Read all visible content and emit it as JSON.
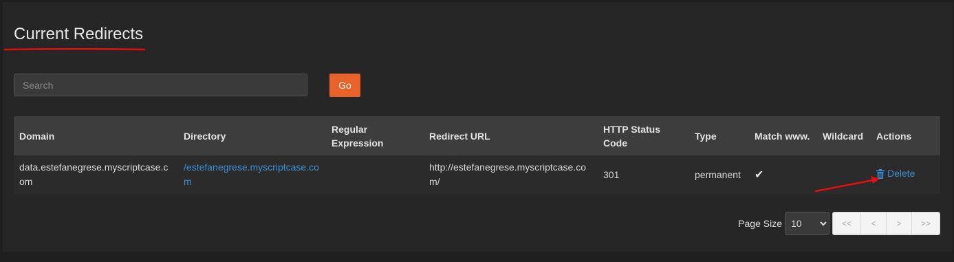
{
  "page": {
    "title": "Current Redirects"
  },
  "search": {
    "placeholder": "Search",
    "value": "",
    "go_label": "Go"
  },
  "table": {
    "headers": {
      "domain": "Domain",
      "directory": "Directory",
      "regex": "Regular Expression",
      "redirect_url": "Redirect URL",
      "http_status": "HTTP Status Code",
      "type": "Type",
      "match_www": "Match www.",
      "wildcard": "Wildcard",
      "actions": "Actions"
    },
    "rows": [
      {
        "domain": "data.estefanegrese.myscriptcase.com",
        "directory": "/estefanegrese.myscriptcase.com",
        "regex": "",
        "redirect_url": "http://estefanegrese.myscriptcase.com/",
        "http_status": "301",
        "type": "permanent",
        "match_www": "✔",
        "wildcard": "",
        "action_label": "Delete"
      }
    ]
  },
  "pager": {
    "page_size_label": "Page Size",
    "page_size_value": "10",
    "first": "<<",
    "prev": "<",
    "next": ">",
    "last": ">>"
  },
  "colors": {
    "accent": "#e8622a",
    "link": "#3b8fd6",
    "annotation": "#e01010"
  },
  "icons": {
    "delete": "trash-icon",
    "match": "check-icon"
  }
}
